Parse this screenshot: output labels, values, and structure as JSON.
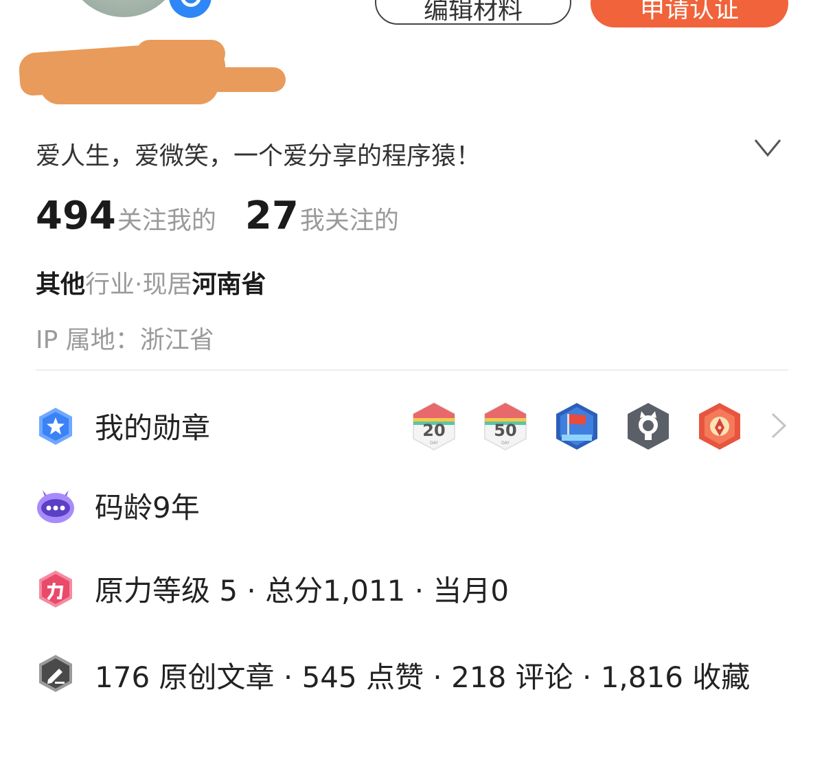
{
  "header": {
    "edit_button_label": "编辑材料",
    "apply_button_label": "申请认证"
  },
  "profile": {
    "bio": "爱人生，爱微笑，一个爱分享的程序猿！",
    "followers_count": "494",
    "followers_label": "关注我的",
    "following_count": "27",
    "following_label": "我关注的",
    "industry": "其他",
    "industry_suffix": "行业·现居",
    "location": "河南省",
    "ip_location": "IP 属地：浙江省"
  },
  "info_rows": {
    "medals_label": "我的勋章",
    "medals": [
      {
        "icon": "20-day-medal-icon",
        "text": "20"
      },
      {
        "icon": "50-day-medal-icon",
        "text": "50"
      },
      {
        "icon": "flag-medal-icon"
      },
      {
        "icon": "github-medal-icon"
      },
      {
        "icon": "pen-medal-icon"
      }
    ],
    "code_age": "码龄9年",
    "force_level": "原力等级 5 · 总分1,011 · 当月0",
    "articles_summary": "176 原创文章 · 545 点赞 · 218 评论 · 1,816 收藏"
  },
  "colors": {
    "accent": "#f0633b",
    "verify_blue": "#2f86f6",
    "muted_text": "#9a9a9a"
  }
}
